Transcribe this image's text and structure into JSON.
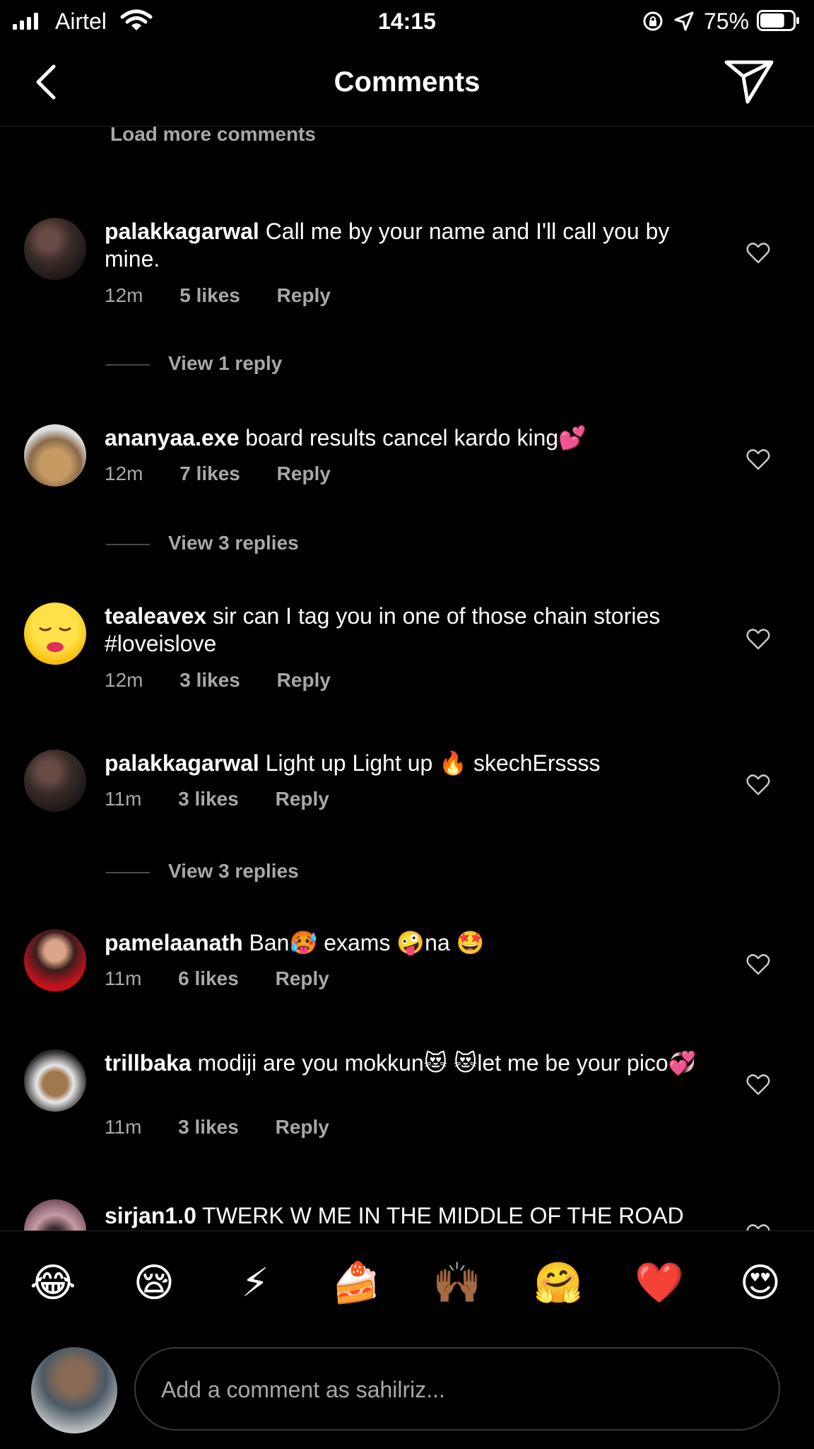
{
  "status_bar": {
    "carrier": "Airtel",
    "time": "14:15",
    "battery": "75%",
    "battery_level": 0.75
  },
  "header": {
    "title": "Comments"
  },
  "load_more": "Load more comments",
  "comments": [
    {
      "username": "palakkagarwal",
      "text": "Call me by your name and I'll call you by mine.",
      "time": "12m",
      "likes": "5 likes",
      "reply": "Reply",
      "view_replies": "View 1 reply"
    },
    {
      "username": "ananyaa.exe",
      "text": "board results cancel kardo king💕",
      "time": "12m",
      "likes": "7 likes",
      "reply": "Reply",
      "view_replies": "View 3 replies"
    },
    {
      "username": "tealeavex",
      "text": "sir can I tag you in one of those chain stories #loveislove",
      "time": "12m",
      "likes": "3 likes",
      "reply": "Reply"
    },
    {
      "username": "palakkagarwal",
      "text": "Light up Light up  🔥  skechErssss",
      "time": "11m",
      "likes": "3 likes",
      "reply": "Reply",
      "view_replies": "View 3 replies"
    },
    {
      "username": "pamelaanath",
      "text": "Ban🥵  exams  🤪na  🤩",
      "time": "11m",
      "likes": "6 likes",
      "reply": "Reply"
    },
    {
      "username": "trillbaka",
      "text": "modiji are you mokkun😻 😻let me be your pico💞",
      "time": "11m",
      "likes": "3 likes",
      "reply": "Reply"
    },
    {
      "username": "sirjan1.0",
      "text": "TWERK W ME IN THE MIDDLE OF THE ROAD"
    }
  ],
  "quick_emojis": [
    "😂",
    "😪",
    "⚡",
    "🍰",
    "🙌🏾",
    "🤗",
    "❤️",
    "😍"
  ],
  "composer": {
    "placeholder": "Add a comment as sahilriz..."
  }
}
